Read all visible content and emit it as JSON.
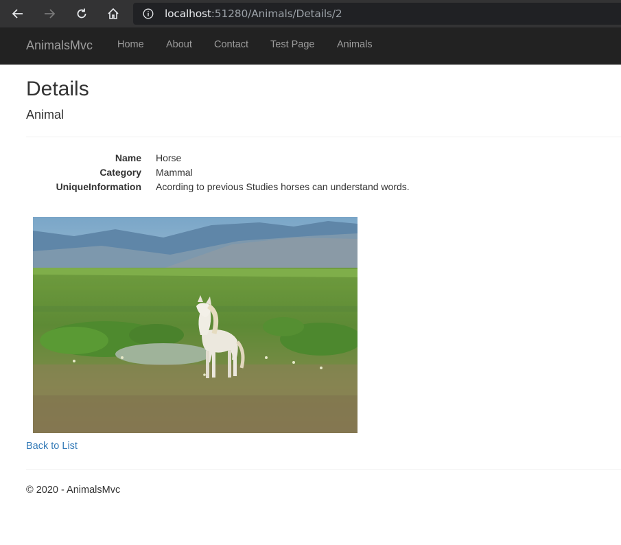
{
  "browser": {
    "url_host": "localhost",
    "url_rest": ":51280/Animals/Details/2"
  },
  "navbar": {
    "brand": "AnimalsMvc",
    "links": [
      "Home",
      "About",
      "Contact",
      "Test Page",
      "Animals"
    ]
  },
  "page": {
    "title": "Details",
    "subtitle": "Animal"
  },
  "details": [
    {
      "term": "Name",
      "value": "Horse"
    },
    {
      "term": "Category",
      "value": "Mammal"
    },
    {
      "term": "UniqueInformation",
      "value": "Acording to previous Studies horses can understand words."
    }
  ],
  "back_link": "Back to List",
  "footer": "© 2020 - AnimalsMvc",
  "colors": {
    "navbar_bg": "#222222",
    "navbar_text": "#9d9d9d",
    "link": "#337ab7",
    "browser_bar": "#333334"
  }
}
